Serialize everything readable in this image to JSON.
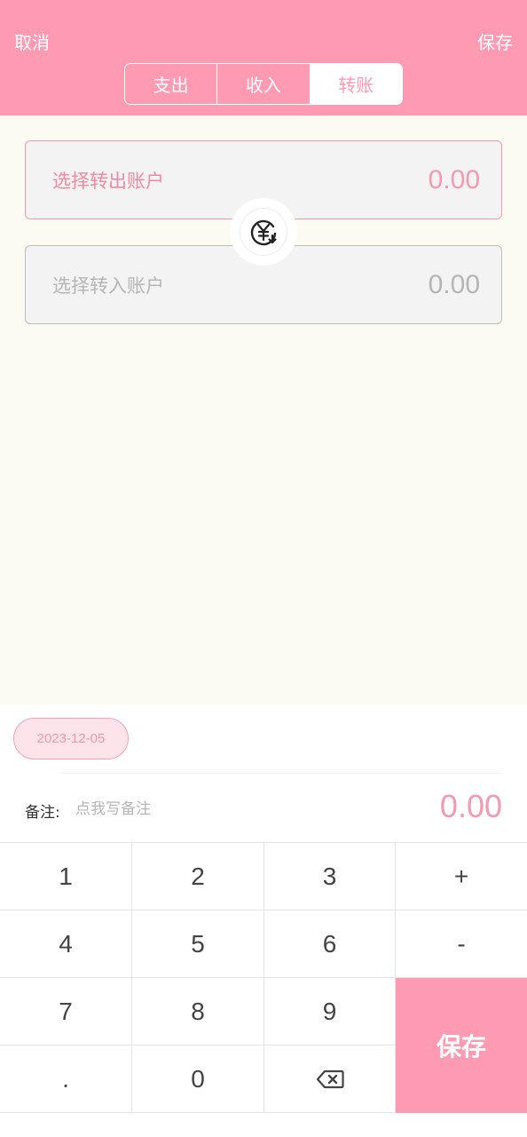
{
  "header": {
    "cancel_label": "取消",
    "save_label": "保存",
    "tabs": [
      {
        "label": "支出",
        "active": false
      },
      {
        "label": "收入",
        "active": false
      },
      {
        "label": "转账",
        "active": true
      }
    ]
  },
  "transfer": {
    "from_label": "选择转出账户",
    "from_amount": "0.00",
    "to_label": "选择转入账户",
    "to_amount": "0.00",
    "swap_icon": "currency-swap-icon"
  },
  "panel": {
    "date": "2023-12-05",
    "note_label": "备注:",
    "note_placeholder": "点我写备注",
    "note_value": "",
    "total": "0.00"
  },
  "keypad": {
    "keys": [
      "1",
      "2",
      "3",
      "+",
      "4",
      "5",
      "6",
      "-",
      "7",
      "8",
      "9",
      ".",
      "0"
    ],
    "backspace_icon": "backspace-icon",
    "save_label": "保存"
  },
  "colors": {
    "accent": "#ff9ab3",
    "accent_text": "#f29ab2",
    "background": "#fcfbf2"
  }
}
